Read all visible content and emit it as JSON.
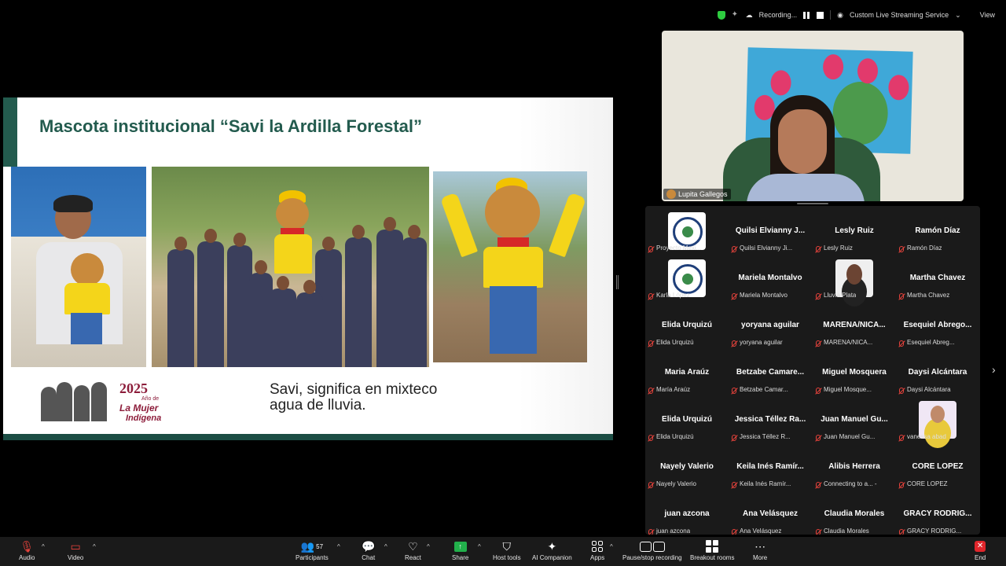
{
  "status_bar": {
    "recording_label": "Recording...",
    "service_label": "Custom Live Streaming Service",
    "view_label": "View"
  },
  "slide": {
    "title": "Mascota institucional “Savi la Ardilla Forestal”",
    "body_text_line1": "Savi, significa en mixteco",
    "body_text_line2": "agua de lluvia.",
    "logo": {
      "year": "2025",
      "line1": "Año de",
      "line2": "La Mujer",
      "line3": "Indígena"
    }
  },
  "speaker": {
    "name": "Lupita Gallegos"
  },
  "gallery": {
    "tiles": [
      {
        "name": "",
        "label": "Proyecto Mexi...",
        "pic": "logo"
      },
      {
        "name": "Quilsi Elvianny J...",
        "label": "Quilsi Elvianny Ji...",
        "pic": ""
      },
      {
        "name": "Lesly Ruiz",
        "label": "Lesly Ruiz",
        "pic": ""
      },
      {
        "name": "Ramón Díaz",
        "label": "Ramón Díaz",
        "pic": ""
      },
      {
        "name": "",
        "label": "Karla López",
        "pic": "logo"
      },
      {
        "name": "Mariela Montalvo",
        "label": "Mariela Montalvo",
        "pic": ""
      },
      {
        "name": "",
        "label": "Lluvia Plata",
        "pic": "woman"
      },
      {
        "name": "Martha Chavez",
        "label": "Martha Chavez",
        "pic": ""
      },
      {
        "name": "Elida Urquizú",
        "label": "Elida Urquizú",
        "pic": ""
      },
      {
        "name": "yoryana aguilar",
        "label": "yoryana aguilar",
        "pic": ""
      },
      {
        "name": "MARENA/NICA...",
        "label": "MARENA/NICA...",
        "pic": ""
      },
      {
        "name": "Esequiel Abrego...",
        "label": "Esequiel Abreg...",
        "pic": ""
      },
      {
        "name": "Maria Araúz",
        "label": "María Araúz",
        "pic": ""
      },
      {
        "name": "Betzabe Camare...",
        "label": "Betzabe Camar...",
        "pic": ""
      },
      {
        "name": "Miguel Mosquera",
        "label": "Miguel Mosque...",
        "pic": ""
      },
      {
        "name": "Daysi Alcántara",
        "label": "Daysi Alcántara",
        "pic": ""
      },
      {
        "name": "Elida Urquizú",
        "label": "Elida Urquizú",
        "pic": ""
      },
      {
        "name": "Jessica Téllez Ra...",
        "label": "Jessica Téllez R...",
        "pic": ""
      },
      {
        "name": "Juan Manuel Gu...",
        "label": "Juan Manuel Gu...",
        "pic": ""
      },
      {
        "name": "",
        "label": "vanessa abad",
        "pic": "vanessa"
      },
      {
        "name": "Nayely Valerio",
        "label": "Nayely Valerio",
        "pic": ""
      },
      {
        "name": "Keila Inés Ramír...",
        "label": "Keila Inés Ramír...",
        "pic": ""
      },
      {
        "name": "Alibis Herrera",
        "label": "Connecting to a... -",
        "pic": ""
      },
      {
        "name": "CORE LOPEZ",
        "label": "CORE LOPEZ",
        "pic": ""
      },
      {
        "name": "juan azcona",
        "label": "juan azcona",
        "pic": ""
      },
      {
        "name": "Ana Velásquez",
        "label": "Ana Velásquez",
        "pic": ""
      },
      {
        "name": "Claudia Morales",
        "label": "Claudia Morales",
        "pic": ""
      },
      {
        "name": "GRACY RODRIG...",
        "label": "GRACY RODRIG...",
        "pic": ""
      }
    ]
  },
  "toolbar": {
    "audio": "Audio",
    "video": "Video",
    "participants": "Participants",
    "participants_count": "57",
    "chat": "Chat",
    "react": "React",
    "share": "Share",
    "host_tools": "Host tools",
    "ai_companion": "AI Companion",
    "apps": "Apps",
    "pause_stop": "Pause/stop recording",
    "breakout": "Breakout rooms",
    "more": "More",
    "end": "End"
  },
  "colors": {
    "slide_green": "#235b4e",
    "logo_maroon": "#8c1c3a",
    "share_green": "#22b04b",
    "end_red": "#e0262c",
    "mute_red": "#e8433c"
  }
}
